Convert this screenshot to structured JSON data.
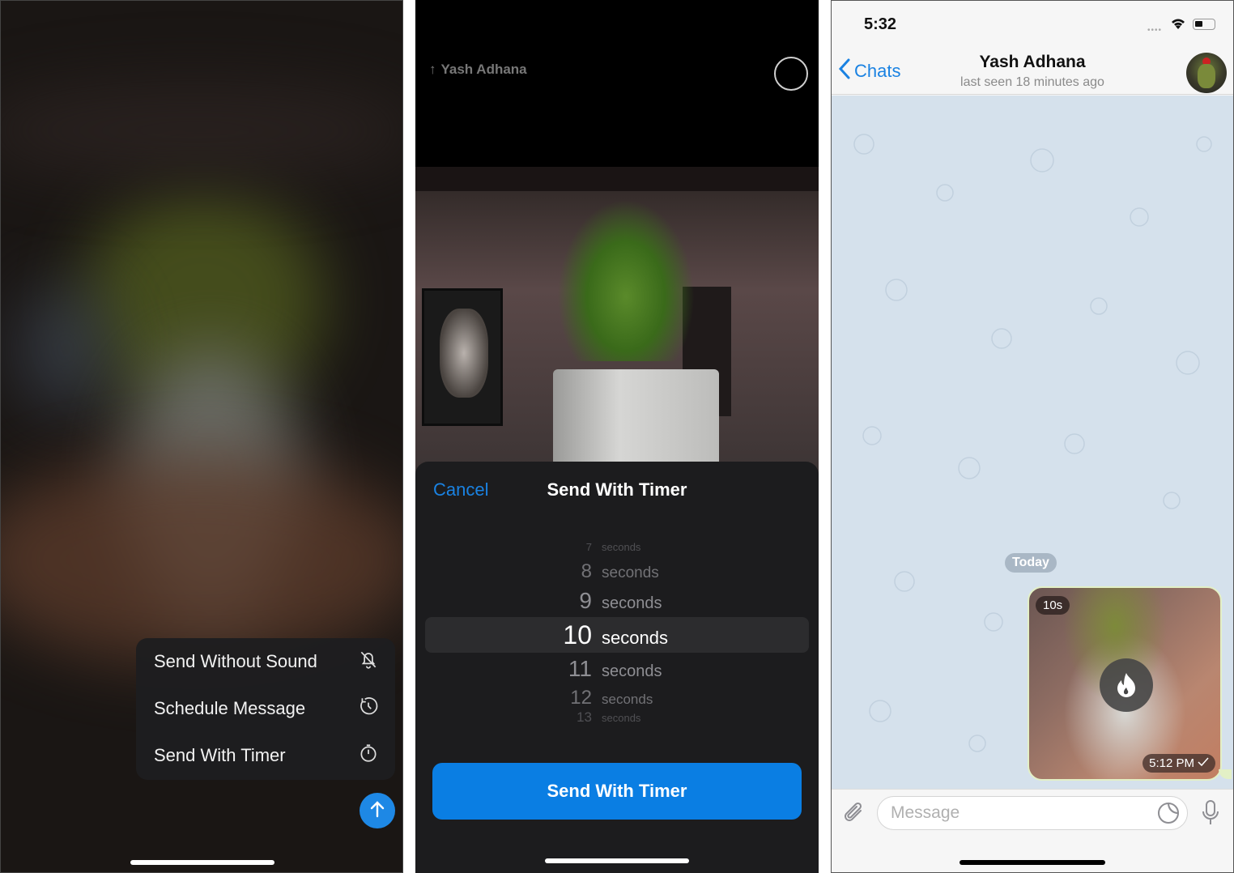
{
  "panel1": {
    "menu_items": [
      {
        "label": "Send Without Sound",
        "icon": "bell-slash-icon"
      },
      {
        "label": "Schedule Message",
        "icon": "clock-arrow-icon"
      },
      {
        "label": "Send With Timer",
        "icon": "stopwatch-icon"
      }
    ],
    "send_button_icon": "arrow-up-icon"
  },
  "panel2": {
    "recipient": "Yash Adhana",
    "sheet": {
      "cancel_label": "Cancel",
      "title": "Send With Timer",
      "picker": [
        {
          "num": "7",
          "unit": "seconds"
        },
        {
          "num": "8",
          "unit": "seconds"
        },
        {
          "num": "9",
          "unit": "seconds"
        },
        {
          "num": "10",
          "unit": "seconds"
        },
        {
          "num": "11",
          "unit": "seconds"
        },
        {
          "num": "12",
          "unit": "seconds"
        },
        {
          "num": "13",
          "unit": "seconds"
        }
      ],
      "selected": "10 seconds",
      "send_label": "Send With Timer"
    }
  },
  "panel3": {
    "status": {
      "time": "5:32"
    },
    "nav": {
      "back_label": "Chats",
      "title": "Yash Adhana",
      "subtitle": "last seen 18 minutes ago"
    },
    "date_separator": "Today",
    "message": {
      "ttl_badge": "10s",
      "time": "5:12 PM",
      "status_icon": "checkmark-icon"
    },
    "input": {
      "placeholder": "Message",
      "value": ""
    },
    "colors": {
      "accent": "#1a82e2",
      "chat_bg": "#d5e1ec",
      "bubble_border": "#e3f0c6"
    }
  }
}
